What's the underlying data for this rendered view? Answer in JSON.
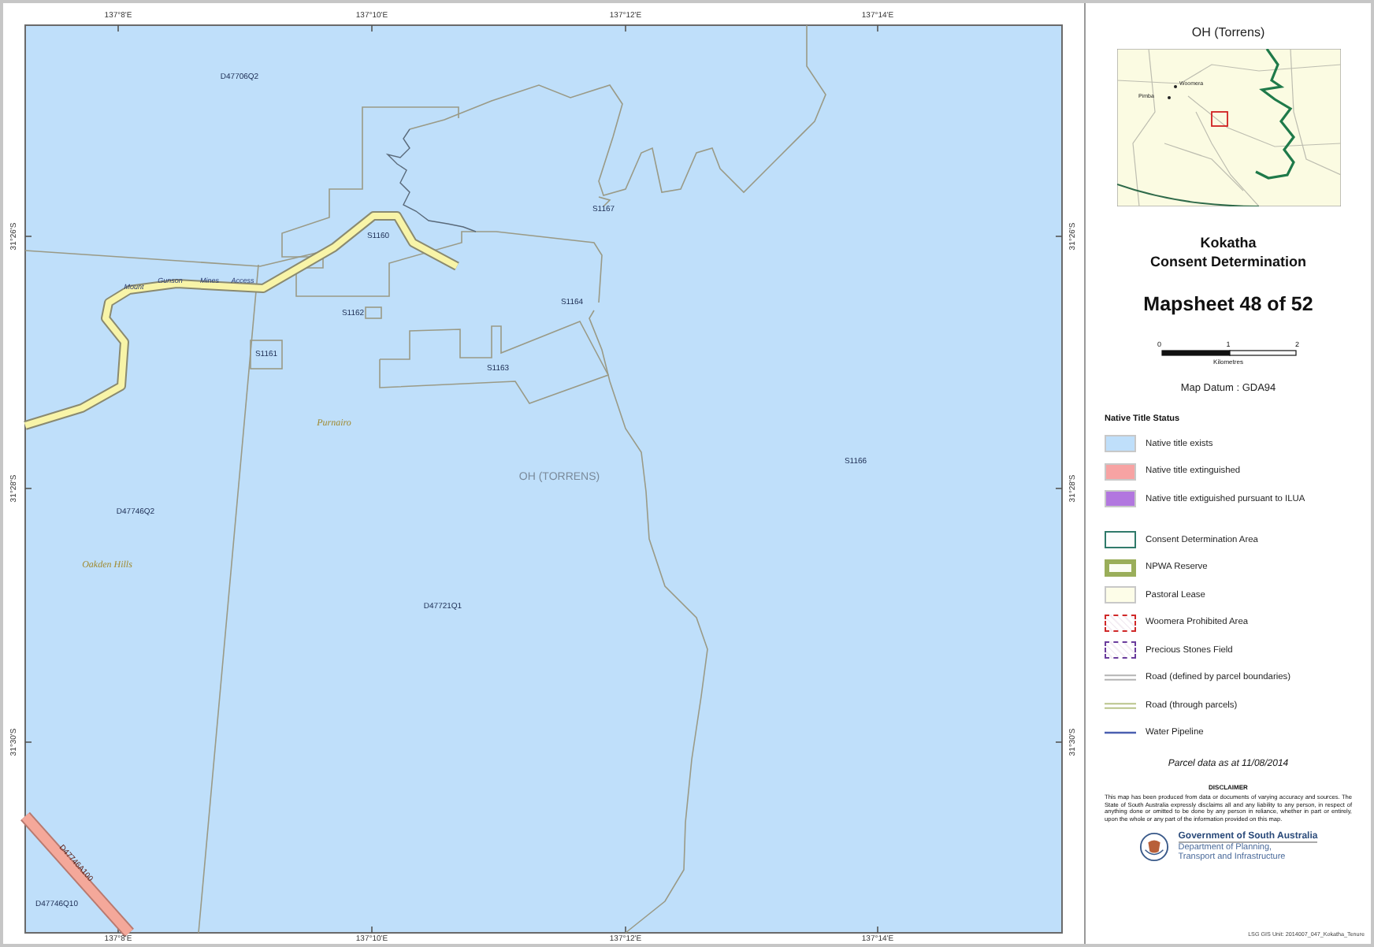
{
  "map": {
    "grid": {
      "top": [
        "137°8'E",
        "137°10'E",
        "137°12'E",
        "137°14'E"
      ],
      "bottom": [
        "137°8'E",
        "137°10'E",
        "137°12'E",
        "137°14'E"
      ],
      "left": [
        "31°26'S",
        "31°28'S",
        "31°30'S"
      ],
      "right": [
        "31°26'S",
        "31°28'S",
        "31°30'S"
      ]
    },
    "labels": [
      {
        "text": "D47706Q2",
        "kind": "parcel"
      },
      {
        "text": "S1167",
        "kind": "parcel"
      },
      {
        "text": "S1160",
        "kind": "parcel"
      },
      {
        "text": "Mount",
        "kind": "road_name"
      },
      {
        "text": "Gunson",
        "kind": "road_name"
      },
      {
        "text": "Mines",
        "kind": "road_name"
      },
      {
        "text": "Access",
        "kind": "road_name"
      },
      {
        "text": "S1164",
        "kind": "parcel"
      },
      {
        "text": "S1162",
        "kind": "parcel"
      },
      {
        "text": "S1161",
        "kind": "parcel"
      },
      {
        "text": "S1163",
        "kind": "parcel"
      },
      {
        "text": "Purnairo",
        "kind": "place"
      },
      {
        "text": "S1166",
        "kind": "parcel"
      },
      {
        "text": "OH (TORRENS)",
        "kind": "area"
      },
      {
        "text": "D47746Q2",
        "kind": "parcel"
      },
      {
        "text": "Oakden Hills",
        "kind": "place"
      },
      {
        "text": "D47721Q1",
        "kind": "parcel"
      },
      {
        "text": "D47746A100",
        "kind": "road_parcel"
      },
      {
        "text": "D47746Q10",
        "kind": "parcel"
      }
    ]
  },
  "panel": {
    "area_title": "OH (Torrens)",
    "inset_labels": [
      "Woomera",
      "Pimba"
    ],
    "title_lines": [
      "Kokatha",
      "Consent Determination"
    ],
    "mapsheet": "Mapsheet 48 of 52",
    "scale": {
      "ticks": [
        "0",
        "1",
        "2"
      ],
      "unit": "Kilometres"
    },
    "datum": "Map Datum : GDA94",
    "legend": [
      {
        "heading": "Native Title Status",
        "items": [
          {
            "label": "Native title exists",
            "kind": "fill",
            "color": "#bfdffa"
          },
          {
            "label": "Native title extinguished",
            "kind": "fill",
            "color": "#f7a3a3"
          },
          {
            "label": "Native title extiguished pursuant to ILUA",
            "kind": "fill",
            "color": "#b277df"
          }
        ]
      },
      {
        "items": [
          {
            "label": "Consent Determination Area",
            "kind": "outline",
            "color": "#2f7a6a"
          },
          {
            "label": "NPWA Reserve",
            "kind": "thick_outline",
            "color": "#9aae5a"
          },
          {
            "label": "Pastoral Lease",
            "kind": "fill",
            "color": "#fdfde8"
          },
          {
            "label": "Woomera Prohibited Area",
            "kind": "dashed_outline",
            "color": "#d02828"
          },
          {
            "label": "Precious Stones Field",
            "kind": "dashed_outline",
            "color": "#6a3c9c"
          },
          {
            "label": "Road (defined by parcel boundaries)",
            "kind": "double_line",
            "color": "#b4b4b4"
          },
          {
            "label": "Road (through parcels)",
            "kind": "double_line",
            "color": "#b9c48a"
          },
          {
            "label": "Water Pipeline",
            "kind": "line",
            "color": "#4a5fb0"
          }
        ]
      }
    ],
    "parcel_date": "Parcel data as at 11/08/2014",
    "disclaimer": {
      "heading": "DISCLAIMER",
      "text": "This map has been produced from data or documents of varying accuracy and sources. The State of South Australia expressly disclaims all and any liability to any person, in respect of anything done or omitted to be done by any person in reliance, whether in part or entirely, upon the whole or any part of the information provided on this map."
    },
    "logo": {
      "name": "Government of South Australia",
      "department_lines": [
        "Department of Planning,",
        "Transport and Infrastructure"
      ]
    },
    "footer": "LSG GIS Unit: 2014007_047_Kokatha_Tenure"
  }
}
